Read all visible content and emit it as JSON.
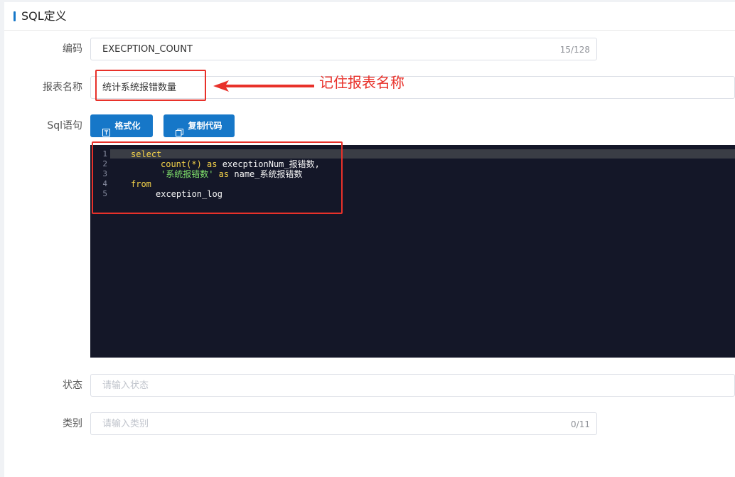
{
  "section": {
    "title": "SQL定义"
  },
  "fields": {
    "code": {
      "label": "编码",
      "value": "EXECPTION_COUNT",
      "counter": "15/128"
    },
    "report_name": {
      "label": "报表名称",
      "value": "统计系统报错数量"
    },
    "sql": {
      "label": "Sql语句"
    },
    "status": {
      "label": "状态",
      "placeholder": "请输入状态"
    },
    "category": {
      "label": "类别",
      "placeholder": "请输入类别",
      "counter": "0/11"
    }
  },
  "buttons": {
    "format_label": "格式化",
    "copy_label": "复制代码"
  },
  "editor": {
    "line_numbers": [
      "1",
      "2",
      "3",
      "4",
      "5"
    ],
    "lines": [
      {
        "kw": "select"
      },
      {
        "fn": "count(*)",
        "kw": " as",
        "rest": " execptionNum_报错数,"
      },
      {
        "str": "'系统报错数'",
        "kw": " as",
        "rest": " name_系统报错数"
      },
      {
        "kw": "from"
      },
      {
        "rest": "exception_log"
      }
    ]
  },
  "annotation": {
    "text": "记住报表名称"
  },
  "colors": {
    "primary": "#1677c8",
    "editor_bg": "#141728",
    "annotation_red": "#e8312a"
  }
}
